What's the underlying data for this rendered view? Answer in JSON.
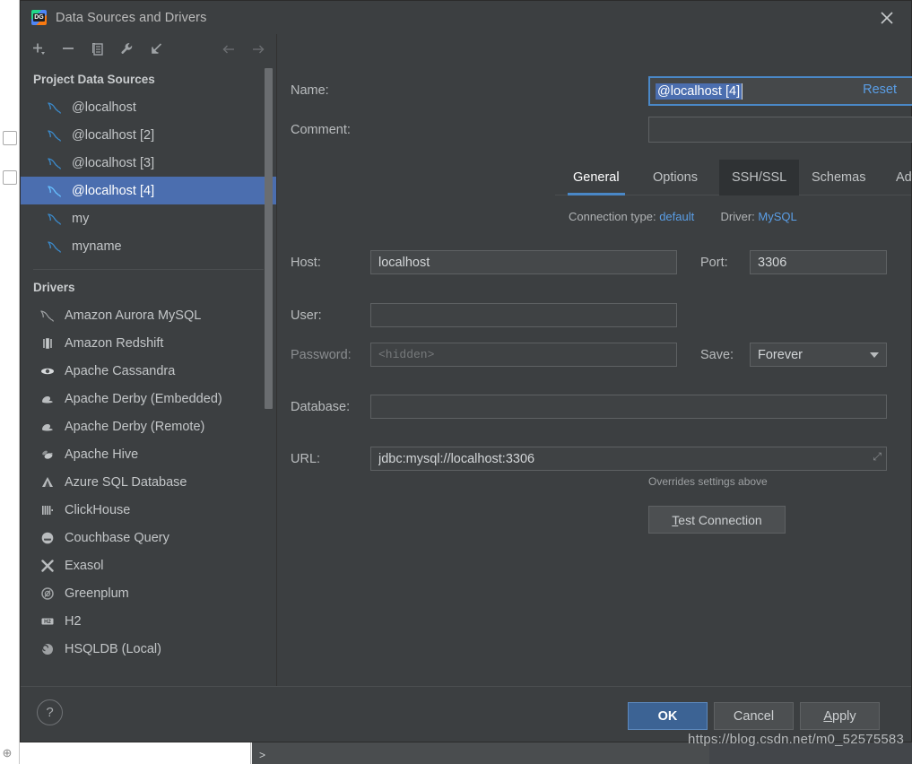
{
  "window": {
    "title": "Data Sources and Drivers",
    "logo_text": "DG",
    "close_icon": "close-icon"
  },
  "toolbar": {
    "items": [
      {
        "name": "add-data-source-button",
        "icon": "plus-dropdown-icon",
        "enabled": true
      },
      {
        "name": "remove-data-source-button",
        "icon": "minus-icon",
        "enabled": true
      },
      {
        "name": "copy-data-source-button",
        "icon": "copy-icon",
        "enabled": true
      },
      {
        "name": "properties-button",
        "icon": "wrench-icon",
        "enabled": true
      },
      {
        "name": "import-button",
        "icon": "import-arrow-icon",
        "enabled": true
      },
      {
        "name": "back-button",
        "icon": "arrow-left-icon",
        "enabled": false
      },
      {
        "name": "forward-button",
        "icon": "arrow-right-icon",
        "enabled": false
      }
    ]
  },
  "sidebar": {
    "project_section_title": "Project Data Sources",
    "data_sources": [
      {
        "label": "@localhost",
        "icon": "mysql-dolphin-icon",
        "selected": false
      },
      {
        "label": "@localhost [2]",
        "icon": "mysql-dolphin-icon",
        "selected": false
      },
      {
        "label": "@localhost [3]",
        "icon": "mysql-dolphin-icon",
        "selected": false
      },
      {
        "label": "@localhost [4]",
        "icon": "mysql-dolphin-icon",
        "selected": true
      },
      {
        "label": "my",
        "icon": "mysql-dolphin-icon",
        "selected": false
      },
      {
        "label": "myname",
        "icon": "mysql-dolphin-icon",
        "selected": false
      }
    ],
    "drivers_section_title": "Drivers",
    "drivers": [
      {
        "label": "Amazon Aurora MySQL",
        "icon": "aurora-dolphin-icon"
      },
      {
        "label": "Amazon Redshift",
        "icon": "redshift-icon"
      },
      {
        "label": "Apache Cassandra",
        "icon": "cassandra-eye-icon"
      },
      {
        "label": "Apache Derby (Embedded)",
        "icon": "derby-hat-icon"
      },
      {
        "label": "Apache Derby (Remote)",
        "icon": "derby-hat-icon"
      },
      {
        "label": "Apache Hive",
        "icon": "hive-bee-icon"
      },
      {
        "label": "Azure SQL Database",
        "icon": "azure-triangle-icon"
      },
      {
        "label": "ClickHouse",
        "icon": "clickhouse-bars-icon"
      },
      {
        "label": "Couchbase Query",
        "icon": "couchbase-icon"
      },
      {
        "label": "Exasol",
        "icon": "exasol-x-icon"
      },
      {
        "label": "Greenplum",
        "icon": "greenplum-circle-icon"
      },
      {
        "label": "H2",
        "icon": "h2-badge-icon"
      },
      {
        "label": "HSQLDB (Local)",
        "icon": "hsqldb-icon"
      }
    ]
  },
  "form": {
    "name_label": "Name:",
    "name_value": "@localhost [4]",
    "comment_label": "Comment:",
    "comment_value": "",
    "reset_label": "Reset",
    "connection_type_label": "Connection type:",
    "connection_type_value": "default",
    "driver_label": "Driver:",
    "driver_value": "MySQL",
    "host_label": "Host:",
    "host_value": "localhost",
    "port_label": "Port:",
    "port_value": "3306",
    "user_label": "User:",
    "user_value": "",
    "password_label": "Password:",
    "password_placeholder": "<hidden>",
    "save_label": "Save:",
    "save_value": "Forever",
    "database_label": "Database:",
    "database_value": "",
    "url_label": "URL:",
    "url_value": "jdbc:mysql://localhost:3306",
    "overrides_note": "Overrides settings above",
    "test_connection_mnemonic": "T",
    "test_connection_rest": "est Connection"
  },
  "tabs": [
    {
      "label": "General",
      "state": "active"
    },
    {
      "label": "Options",
      "state": "normal"
    },
    {
      "label": "SSH/SSL",
      "state": "hover"
    },
    {
      "label": "Schemas",
      "state": "normal"
    },
    {
      "label": "Advanced",
      "state": "normal"
    }
  ],
  "footer": {
    "help_label": "?",
    "ok_label": "OK",
    "cancel_label": "Cancel",
    "apply_mnemonic": "A",
    "apply_rest": "pply"
  },
  "watermark": "https://blog.csdn.net/m0_52575583",
  "background": {
    "prompt_glyph": ">"
  },
  "colors": {
    "dialog_bg": "#3c3f41",
    "selection_blue": "#4b6eaf",
    "link_blue": "#5a9ee6",
    "accent_tab": "#4a88c7",
    "ok_button": "#3c6394",
    "mysql_icon": "#3b89c9",
    "field_bg": "#45484a"
  }
}
